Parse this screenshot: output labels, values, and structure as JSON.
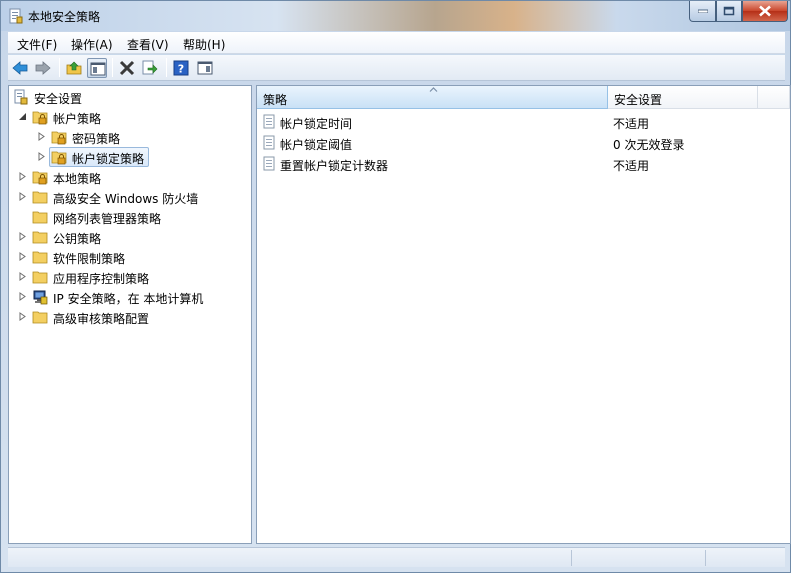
{
  "window": {
    "title": "本地安全策略",
    "accent": "#c9452b"
  },
  "menu": {
    "items": [
      {
        "label": "文件(F)"
      },
      {
        "label": "操作(A)"
      },
      {
        "label": "查看(V)"
      },
      {
        "label": "帮助(H)"
      }
    ]
  },
  "toolbar": {
    "buttons": [
      {
        "icon": "back-arrow-icon"
      },
      {
        "icon": "forward-arrow-icon"
      },
      {
        "icon": "up-one-level-icon"
      },
      {
        "icon": "show-hide-console-tree-icon"
      },
      {
        "icon": "delete-icon"
      },
      {
        "icon": "export-list-icon"
      },
      {
        "icon": "help-icon"
      },
      {
        "icon": "show-hide-action-pane-icon"
      }
    ]
  },
  "tree": {
    "root": "安全设置",
    "items": [
      {
        "label": "帐户策略",
        "expanded": true
      },
      {
        "label": "密码策略"
      },
      {
        "label": "帐户锁定策略",
        "selected": true
      },
      {
        "label": "本地策略"
      },
      {
        "label": "高级安全 Windows 防火墙"
      },
      {
        "label": "网络列表管理器策略"
      },
      {
        "label": "公钥策略"
      },
      {
        "label": "软件限制策略"
      },
      {
        "label": "应用程序控制策略"
      },
      {
        "label": "IP 安全策略，在 本地计算机"
      },
      {
        "label": "高级审核策略配置"
      }
    ]
  },
  "list": {
    "columns": [
      "策略",
      "安全设置"
    ],
    "rows": [
      {
        "policy": "帐户锁定时间",
        "setting": "不适用"
      },
      {
        "policy": "帐户锁定阈值",
        "setting": "0 次无效登录"
      },
      {
        "policy": "重置帐户锁定计数器",
        "setting": "不适用"
      }
    ]
  }
}
